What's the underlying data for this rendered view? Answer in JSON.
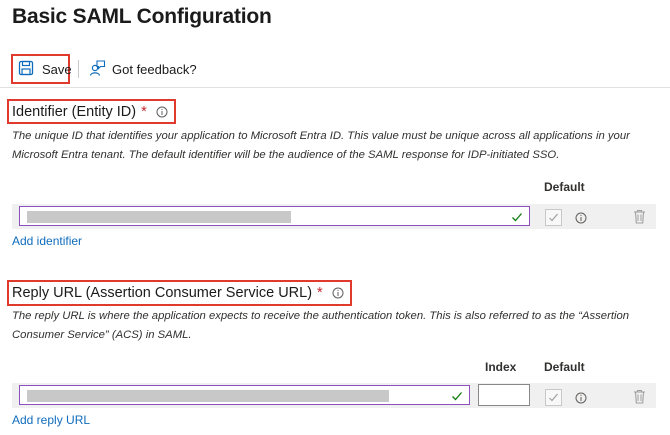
{
  "page": {
    "title": "Basic SAML Configuration"
  },
  "toolbar": {
    "save_label": "Save",
    "feedback_label": "Got feedback?"
  },
  "identifier": {
    "heading": "Identifier (Entity ID)",
    "required_mark": "*",
    "description_line1": "The unique ID that identifies your application to Microsoft Entra ID. This value must be unique across all applications in your",
    "description_line2": "Microsoft Entra tenant. The default identifier will be the audience of the SAML response for IDP-initiated SSO.",
    "default_col": "Default",
    "add_link": "Add identifier"
  },
  "reply_url": {
    "heading": "Reply URL (Assertion Consumer Service URL)",
    "required_mark": "*",
    "description_line1": "The reply URL is where the application expects to receive the authentication token. This is also referred to as the “Assertion",
    "description_line2": "Consumer Service” (ACS) in SAML.",
    "index_col": "Index",
    "default_col": "Default",
    "add_link": "Add reply URL"
  },
  "colors": {
    "accent_red": "#e03a2f",
    "link_blue": "#0f6cbd",
    "input_purple": "#8e4fbf",
    "check_green": "#107c10",
    "required_red": "#c4262e"
  },
  "icons": {
    "save": "floppy-disk-icon",
    "feedback": "person-feedback-icon",
    "info": "info-circle-icon",
    "valid": "checkmark-icon",
    "delete": "trash-can-icon"
  }
}
